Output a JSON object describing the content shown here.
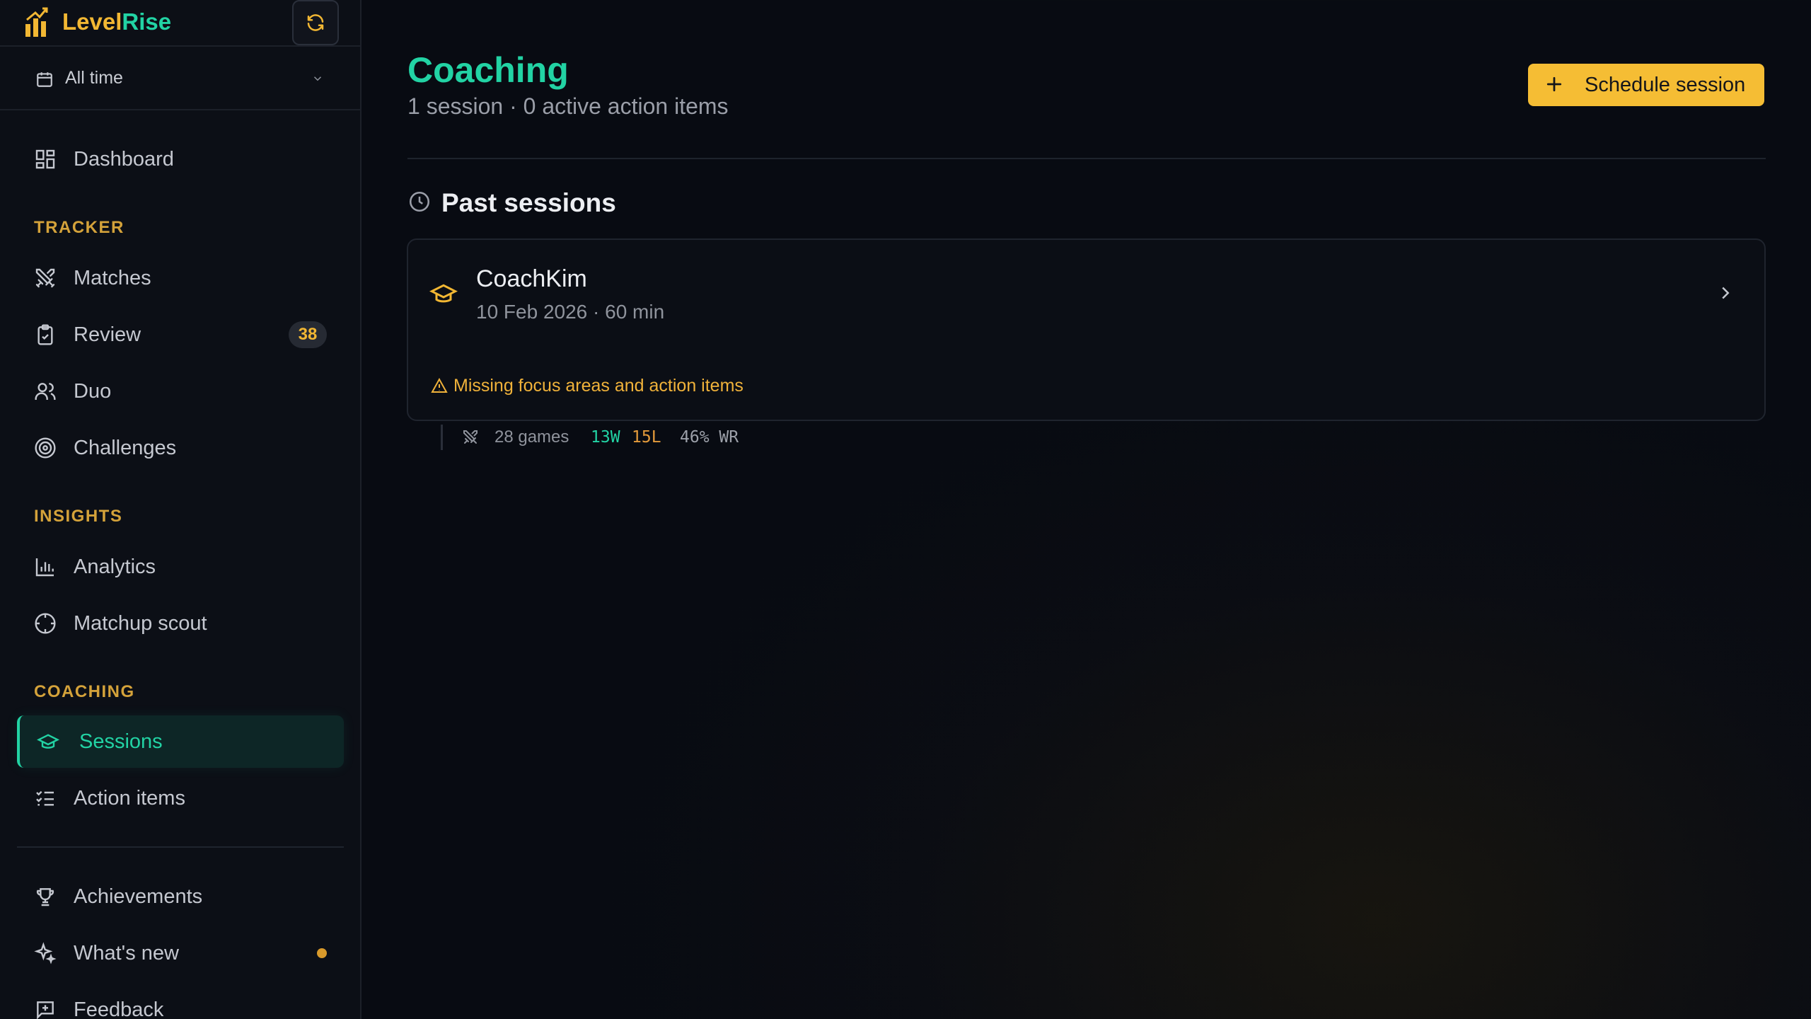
{
  "app": {
    "name_part1": "Level",
    "name_part2": "Rise"
  },
  "filter": {
    "label": "All time"
  },
  "nav": {
    "dashboard": "Dashboard",
    "tracker_label": "TRACKER",
    "matches": "Matches",
    "review": "Review",
    "review_badge": "38",
    "duo": "Duo",
    "challenges": "Challenges",
    "insights_label": "INSIGHTS",
    "analytics": "Analytics",
    "matchup_scout": "Matchup scout",
    "coaching_label": "COACHING",
    "sessions": "Sessions",
    "action_items": "Action items",
    "achievements": "Achievements",
    "whats_new": "What's new",
    "feedback": "Feedback"
  },
  "header": {
    "title": "Coaching",
    "subtitle": "1 session · 0 active action items",
    "schedule_label": "Schedule session"
  },
  "past_sessions": {
    "heading": "Past sessions",
    "items": [
      {
        "coach": "CoachKim",
        "meta": "10 Feb 2026 · 60 min",
        "warning": "Missing focus areas and action items",
        "games": "28 games",
        "wins": "13W",
        "losses": "15L",
        "winrate": "46% WR"
      }
    ]
  },
  "colors": {
    "accent": "#22d3a4",
    "brand": "#f2b733",
    "button": "#f5bd34",
    "warning": "#f0b23a",
    "background": "#0b0d13"
  }
}
